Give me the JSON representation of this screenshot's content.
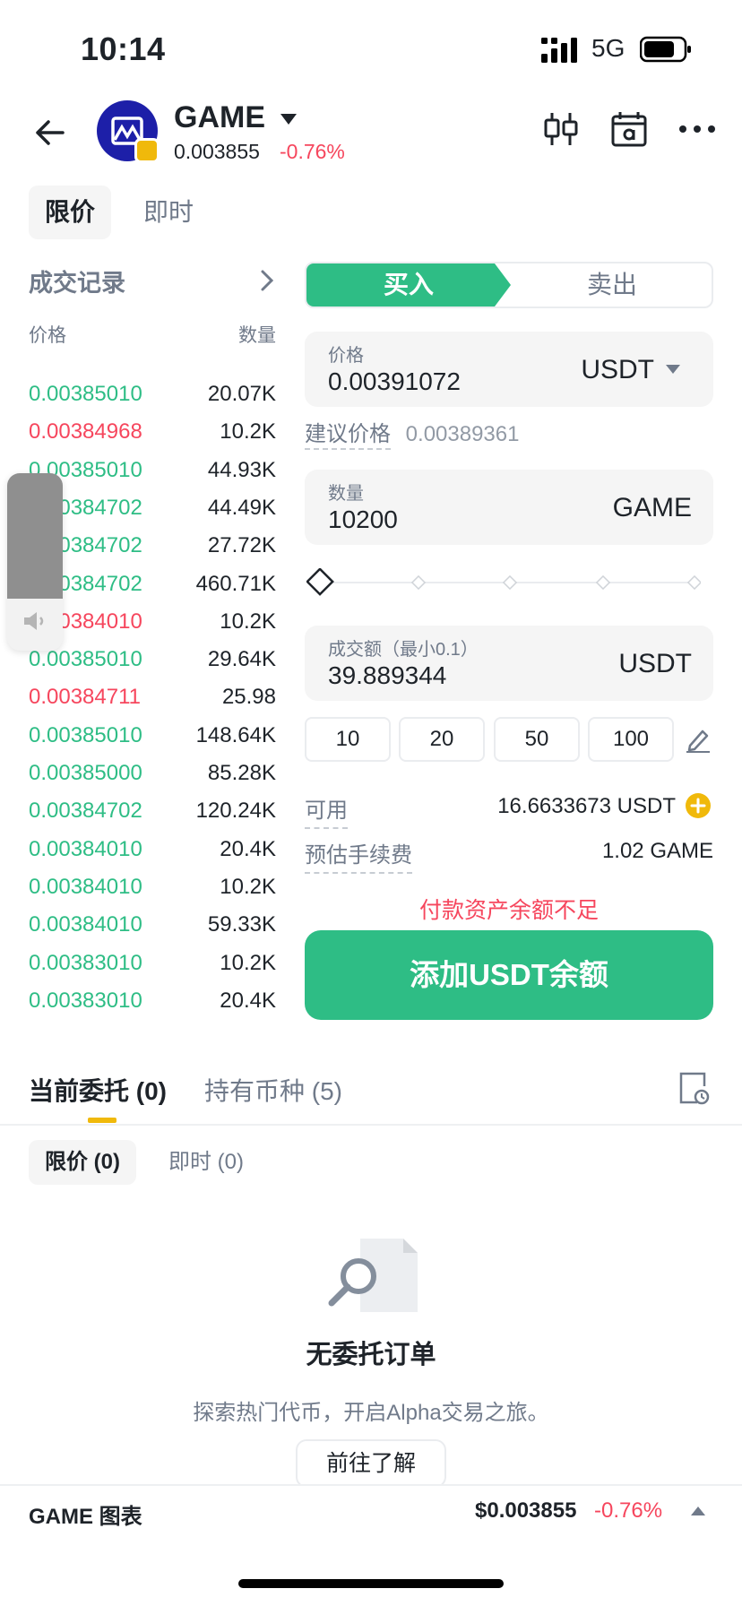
{
  "status_bar": {
    "time": "10:14",
    "network": "5G"
  },
  "header": {
    "token_name": "GAME",
    "price": "0.003855",
    "change": "-0.76%",
    "icons": [
      "back-arrow-icon",
      "candlestick-chart-icon",
      "calendar-alpha-icon",
      "more-icon"
    ]
  },
  "order_type_tabs": [
    {
      "label": "限价",
      "active": true
    },
    {
      "label": "即时",
      "active": false
    }
  ],
  "trades": {
    "title": "成交记录",
    "price_header": "价格",
    "qty_header": "数量",
    "rows": [
      {
        "price": "0.00385010",
        "qty": "20.07K",
        "side": "up"
      },
      {
        "price": "0.00384968",
        "qty": "10.2K",
        "side": "down"
      },
      {
        "price": "0.00385010",
        "qty": "44.93K",
        "side": "up"
      },
      {
        "price": "0.00384702",
        "qty": "44.49K",
        "side": "up"
      },
      {
        "price": "0.00384702",
        "qty": "27.72K",
        "side": "up"
      },
      {
        "price": "0.00384702",
        "qty": "460.71K",
        "side": "up"
      },
      {
        "price": "0.00384010",
        "qty": "10.2K",
        "side": "down"
      },
      {
        "price": "0.00385010",
        "qty": "29.64K",
        "side": "up"
      },
      {
        "price": "0.00384711",
        "qty": "25.98",
        "side": "down"
      },
      {
        "price": "0.00385010",
        "qty": "148.64K",
        "side": "up"
      },
      {
        "price": "0.00385000",
        "qty": "85.28K",
        "side": "up"
      },
      {
        "price": "0.00384702",
        "qty": "120.24K",
        "side": "up"
      },
      {
        "price": "0.00384010",
        "qty": "20.4K",
        "side": "up"
      },
      {
        "price": "0.00384010",
        "qty": "10.2K",
        "side": "up"
      },
      {
        "price": "0.00384010",
        "qty": "59.33K",
        "side": "up"
      },
      {
        "price": "0.00383010",
        "qty": "10.2K",
        "side": "up"
      },
      {
        "price": "0.00383010",
        "qty": "20.4K",
        "side": "up"
      }
    ]
  },
  "trade_panel": {
    "buy_label": "买入",
    "sell_label": "卖出",
    "price_field": {
      "label": "价格",
      "value": "0.00391072",
      "unit": "USDT"
    },
    "suggest_label": "建议价格",
    "suggest_value": "0.00389361",
    "qty_field": {
      "label": "数量",
      "value": "10200",
      "unit": "GAME"
    },
    "slider_level": 0,
    "total_field": {
      "label": "成交额（最小0.1）",
      "value": "39.889344",
      "unit": "USDT"
    },
    "quick_amounts": [
      "10",
      "20",
      "50",
      "100"
    ],
    "available_label": "可用",
    "available_value": "16.6633673 USDT",
    "fee_label": "预估手续费",
    "fee_value": "1.02 GAME",
    "warning": "付款资产余额不足",
    "cta_label": "添加USDT余额"
  },
  "bottom_tabs": {
    "orders_label": "当前委托 (0)",
    "holdings_label": "持有币种 (5)",
    "sub_tabs": [
      {
        "label": "限价 (0)",
        "active": true
      },
      {
        "label": "即时 (0)",
        "active": false
      }
    ],
    "empty_title": "无委托订单",
    "empty_subtitle": "探索热门代币，开启Alpha交易之旅。",
    "learn_button": "前往了解"
  },
  "chart_bar": {
    "name": "GAME 图表",
    "price": "$0.003855",
    "change": "-0.76%"
  },
  "colors": {
    "up": "#2ebd85",
    "down": "#f6465d",
    "accent": "#f0b90b",
    "text": "#1e2329",
    "muted": "#707a8a"
  }
}
